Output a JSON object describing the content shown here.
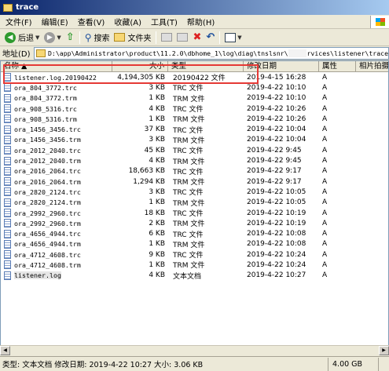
{
  "window": {
    "title": "trace"
  },
  "menu": [
    "文件(F)",
    "编辑(E)",
    "查看(V)",
    "收藏(A)",
    "工具(T)",
    "帮助(H)"
  ],
  "toolbar": {
    "back_label": "后退",
    "search_label": "搜索",
    "folders_label": "文件夹"
  },
  "address": {
    "label": "地址(D)",
    "path_start": "D:\\app\\Administrator\\product\\11.2.0\\dbhome_1\\log\\diag\\tnslsnr\\",
    "path_end": "rvices\\listener\\trace"
  },
  "columns": {
    "name": "名称 ▲",
    "size": "大小",
    "type": "类型",
    "date": "修改日期",
    "attr": "属性",
    "comp": "相片拍摄"
  },
  "files": [
    {
      "name": "listener.log.20190422",
      "size": "4,194,305 KB",
      "type": "20190422 文件",
      "date": "2019-4-15 16:28",
      "attr": "A"
    },
    {
      "name": "ora_804_3772.trc",
      "size": "3 KB",
      "type": "TRC 文件",
      "date": "2019-4-22 10:10",
      "attr": "A"
    },
    {
      "name": "ora_804_3772.trm",
      "size": "1 KB",
      "type": "TRM 文件",
      "date": "2019-4-22 10:10",
      "attr": "A"
    },
    {
      "name": "ora_908_5316.trc",
      "size": "4 KB",
      "type": "TRC 文件",
      "date": "2019-4-22 10:26",
      "attr": "A"
    },
    {
      "name": "ora_908_5316.trm",
      "size": "1 KB",
      "type": "TRM 文件",
      "date": "2019-4-22 10:26",
      "attr": "A"
    },
    {
      "name": "ora_1456_3456.trc",
      "size": "37 KB",
      "type": "TRC 文件",
      "date": "2019-4-22 10:04",
      "attr": "A"
    },
    {
      "name": "ora_1456_3456.trm",
      "size": "3 KB",
      "type": "TRM 文件",
      "date": "2019-4-22 10:04",
      "attr": "A"
    },
    {
      "name": "ora_2012_2040.trc",
      "size": "45 KB",
      "type": "TRC 文件",
      "date": "2019-4-22 9:45",
      "attr": "A"
    },
    {
      "name": "ora_2012_2040.trm",
      "size": "4 KB",
      "type": "TRM 文件",
      "date": "2019-4-22 9:45",
      "attr": "A"
    },
    {
      "name": "ora_2016_2064.trc",
      "size": "18,663 KB",
      "type": "TRC 文件",
      "date": "2019-4-22 9:17",
      "attr": "A"
    },
    {
      "name": "ora_2016_2064.trm",
      "size": "1,294 KB",
      "type": "TRM 文件",
      "date": "2019-4-22 9:17",
      "attr": "A"
    },
    {
      "name": "ora_2820_2124.trc",
      "size": "3 KB",
      "type": "TRC 文件",
      "date": "2019-4-22 10:05",
      "attr": "A"
    },
    {
      "name": "ora_2820_2124.trm",
      "size": "1 KB",
      "type": "TRM 文件",
      "date": "2019-4-22 10:05",
      "attr": "A"
    },
    {
      "name": "ora_2992_2960.trc",
      "size": "18 KB",
      "type": "TRC 文件",
      "date": "2019-4-22 10:19",
      "attr": "A"
    },
    {
      "name": "ora_2992_2960.trm",
      "size": "2 KB",
      "type": "TRM 文件",
      "date": "2019-4-22 10:19",
      "attr": "A"
    },
    {
      "name": "ora_4656_4944.trc",
      "size": "6 KB",
      "type": "TRC 文件",
      "date": "2019-4-22 10:08",
      "attr": "A"
    },
    {
      "name": "ora_4656_4944.trm",
      "size": "1 KB",
      "type": "TRM 文件",
      "date": "2019-4-22 10:08",
      "attr": "A"
    },
    {
      "name": "ora_4712_4608.trc",
      "size": "9 KB",
      "type": "TRC 文件",
      "date": "2019-4-22 10:24",
      "attr": "A"
    },
    {
      "name": "ora_4712_4608.trm",
      "size": "1 KB",
      "type": "TRM 文件",
      "date": "2019-4-22 10:24",
      "attr": "A"
    },
    {
      "name": "listener.log",
      "size": "4 KB",
      "type": "文本文档",
      "date": "2019-4-22 10:27",
      "attr": "A"
    }
  ],
  "status": {
    "text": "类型: 文本文档 修改日期: 2019-4-22 10:27 大小: 3.06 KB",
    "size": "4.00 GB"
  }
}
